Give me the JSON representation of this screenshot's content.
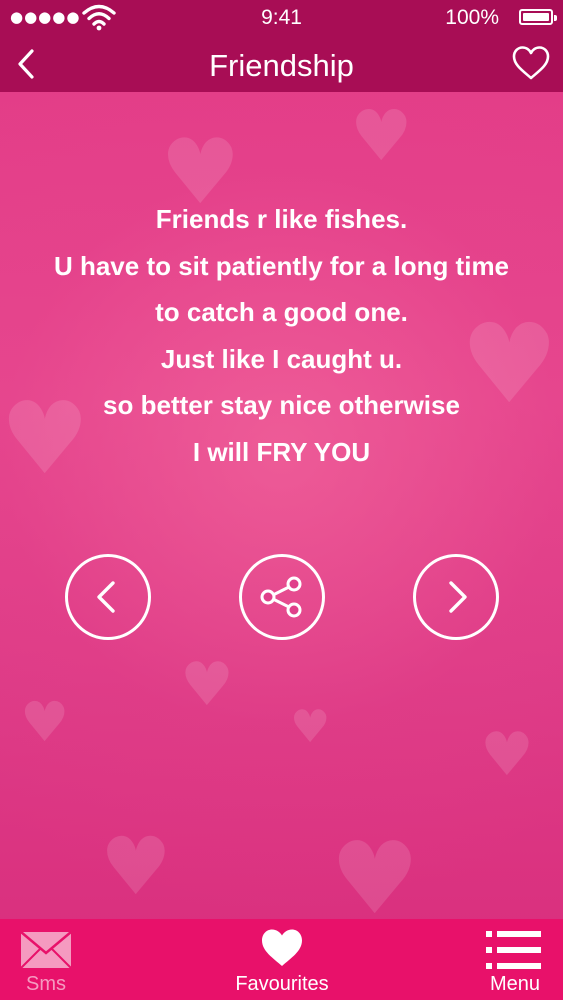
{
  "status_bar": {
    "signal": "●●●●●",
    "time": "9:41",
    "battery": "100%"
  },
  "nav": {
    "title": "Friendship",
    "back_icon": "chevron-left-icon",
    "favorite_icon": "heart-outline-icon"
  },
  "quote": {
    "lines": [
      "Friends r like fishes.",
      "U have to sit patiently for a long time",
      "to catch a good one.",
      "Just like I caught u.",
      "so better stay nice otherwise",
      "I will FRY YOU"
    ]
  },
  "controls": {
    "previous_icon": "chevron-left-circle-icon",
    "share_icon": "share-icon",
    "next_icon": "chevron-right-circle-icon"
  },
  "tabs": [
    {
      "label": "Sms",
      "icon": "envelope-icon",
      "active": false
    },
    {
      "label": "Favourites",
      "icon": "heart-icon",
      "active": true
    },
    {
      "label": "Menu",
      "icon": "list-icon",
      "active": true
    }
  ],
  "colors": {
    "header": "#a80d55",
    "background": "#e0408a",
    "tabbar": "#e8116a",
    "inactive_tab": "#f59ac0"
  }
}
